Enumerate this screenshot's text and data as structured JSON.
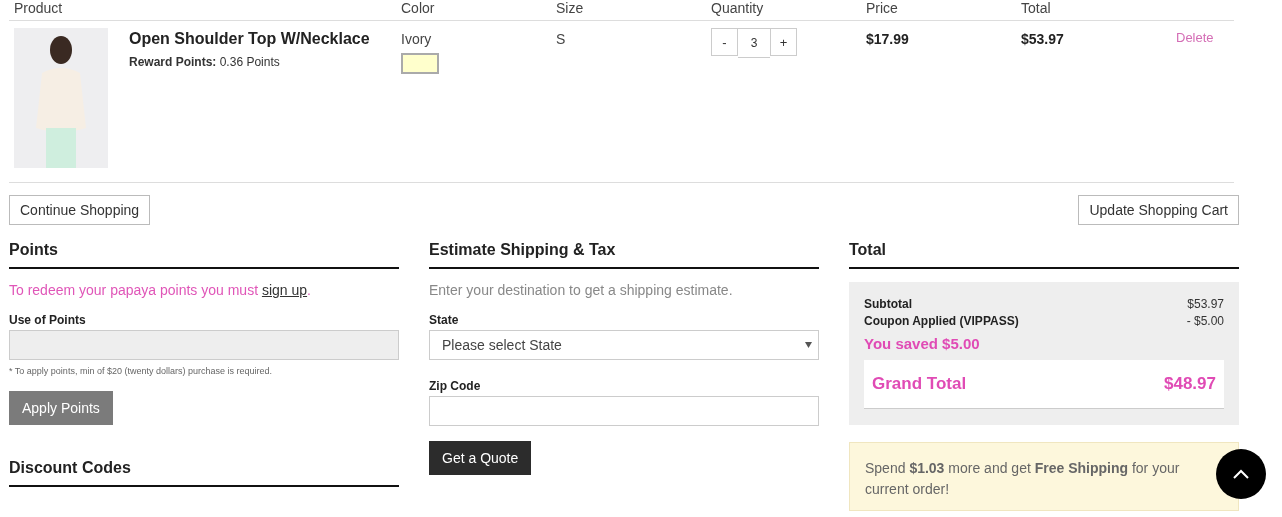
{
  "table": {
    "columns": [
      "Product",
      "Color",
      "Size",
      "Quantity",
      "Price",
      "Total"
    ],
    "rows": [
      {
        "name": "Open Shoulder Top W/Necklace",
        "reward_label": "Reward Points:",
        "reward_value": "0.36 Points",
        "color_name": "Ivory",
        "color": "#ffffcc",
        "size": "S",
        "quantity": "3",
        "decrement": "-",
        "increment": "+",
        "price": "$17.99",
        "total": "$53.97",
        "delete": "Delete"
      }
    ]
  },
  "buttons": {
    "continue": "Continue Shopping",
    "update": "Update Shopping Cart"
  },
  "points": {
    "title": "Points",
    "message": "To redeem your papaya points you must",
    "link": "sign up",
    "after_link": ".",
    "field_label": "Use of Points",
    "note": "* To apply points, min of $20 (twenty dollars) purchase is required.",
    "button": "Apply Points"
  },
  "discount": {
    "title": "Discount Codes"
  },
  "shipping": {
    "title": "Estimate Shipping & Tax",
    "intro": "Enter your destination to get a shipping estimate.",
    "state_label": "State",
    "state_placeholder": "Please select State",
    "zip_label": "Zip Code",
    "button": "Get a Quote"
  },
  "totals": {
    "title": "Total",
    "lines": [
      {
        "label": "Subtotal",
        "value": "$53.97"
      },
      {
        "label": "Coupon Applied (VIPPASS)",
        "value": "- $5.00"
      }
    ],
    "saved": "You saved $5.00",
    "grand_label": "Grand Total",
    "grand_value": "$48.97"
  },
  "free_shipping": "Spend **$1.03** more and get **Free Shipping** for your current order!"
}
